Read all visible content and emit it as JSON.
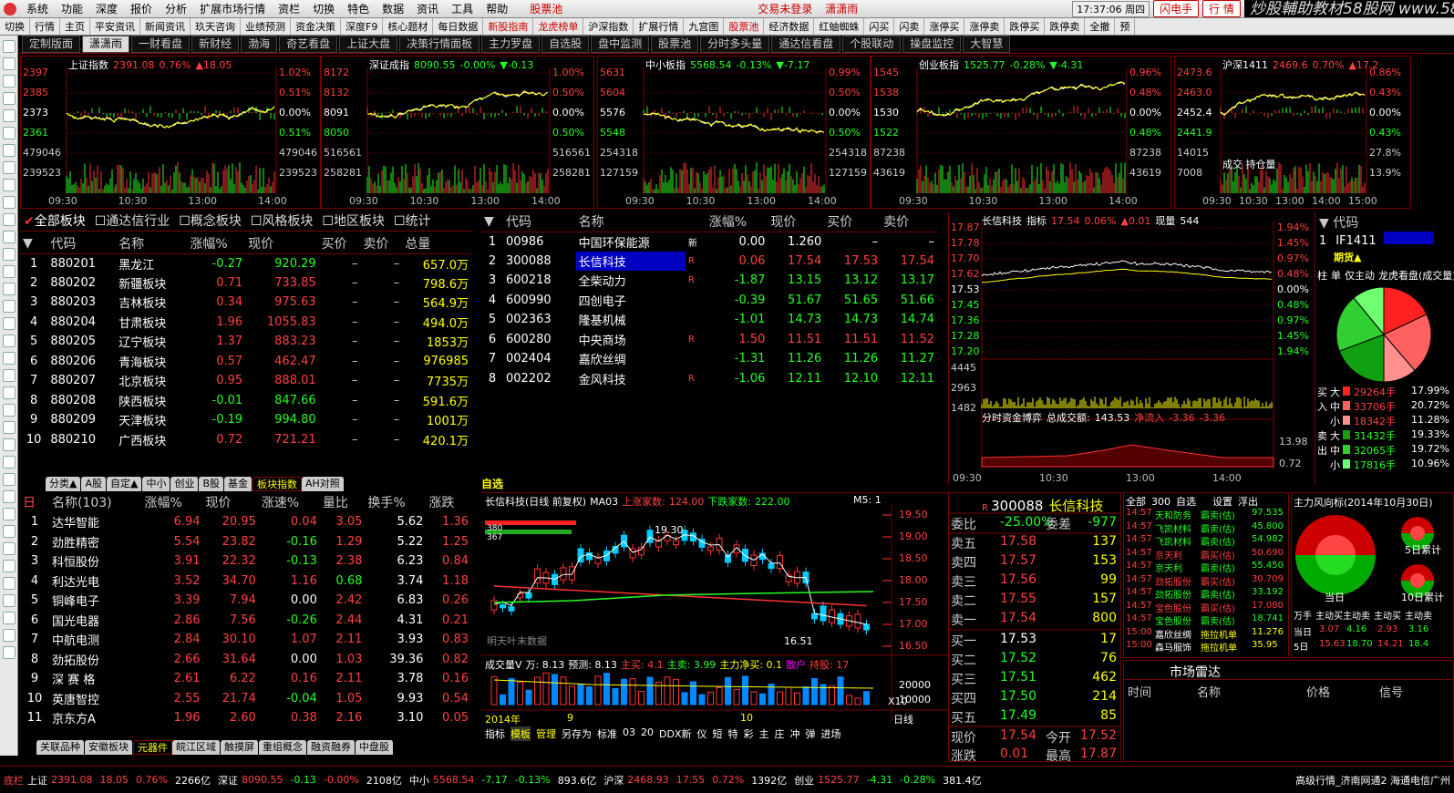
{
  "menu": {
    "items": [
      "系统",
      "功能",
      "深度",
      "报价",
      "分析",
      "扩展市场行情",
      "资栏",
      "切换",
      "特色",
      "数据",
      "资讯",
      "工具",
      "帮助"
    ],
    "stock_pool": "股票池",
    "trade_status": "交易未登录",
    "user": "潇潇雨",
    "clock": "17:37:06 周四",
    "flash_btn": "闪电手",
    "quote_btn": "行 情"
  },
  "watermark": "炒股輔助教材58股网 www.58Gu.com",
  "toolbar2": [
    "切换",
    "行情",
    "主页",
    "平安资讯",
    "新闻资讯",
    "玖天咨询",
    "业绩预测",
    "资金决策",
    "深度F9",
    "核心题材",
    "每日数据",
    "新股指南",
    "龙虎榜单",
    "沪深指数",
    "扩展行情",
    "九宫图",
    "股票池",
    "经济数据",
    "红蚰蜘蛛",
    "闪买",
    "闪卖",
    "涨停买",
    "涨停卖",
    "跌停买",
    "跌停卖",
    "全撤",
    "预"
  ],
  "toolbar3": [
    "定制版面",
    "潇潇雨",
    "一财看盘",
    "新财经",
    "渤海",
    "奇艺看盘",
    "上证大盘",
    "决策行情面板",
    "主力罗盘",
    "自选股",
    "盘中监测",
    "股票池",
    "分时多头量",
    "通达信看盘",
    "个股联动",
    "操盘监控",
    "大智慧"
  ],
  "minis": [
    {
      "name": "上证指数",
      "price": "2391.08",
      "pct": "0.76%",
      "chg": "▲18.05",
      "yl": [
        "2397",
        "2385",
        "2373",
        "2361",
        "479046",
        "239523"
      ],
      "pl": [
        "1.02%",
        "0.51%",
        "0.00%",
        "0.51%",
        "479046",
        "239523"
      ],
      "times": [
        "09:30",
        "10:30",
        "13:00",
        "14:00"
      ]
    },
    {
      "name": "深证成指",
      "price": "8090.55",
      "pct": "-0.00%",
      "chg": "▼-0.13",
      "yl": [
        "8172",
        "8132",
        "8091",
        "8050",
        "516561",
        "258281"
      ],
      "pl": [
        "1.00%",
        "0.50%",
        "0.00%",
        "0.50%",
        "516561",
        "258281"
      ],
      "times": [
        "09:30",
        "10:30",
        "13:00",
        "14:00"
      ]
    },
    {
      "name": "中小板指",
      "price": "5568.54",
      "pct": "-0.13%",
      "chg": "▼-7.17",
      "yl": [
        "5631",
        "5604",
        "5576",
        "5548",
        "254318",
        "127159"
      ],
      "pl": [
        "0.99%",
        "0.50%",
        "0.00%",
        "0.50%",
        "254318",
        "127159"
      ],
      "times": [
        "09:30",
        "10:30",
        "13:00",
        "14:00"
      ]
    },
    {
      "name": "创业板指",
      "price": "1525.77",
      "pct": "-0.28%",
      "chg": "▼-4.31",
      "yl": [
        "1545",
        "1538",
        "1530",
        "1522",
        "87238",
        "43619"
      ],
      "pl": [
        "0.96%",
        "0.48%",
        "0.00%",
        "0.48%",
        "87238",
        "43619"
      ],
      "times": [
        "09:30",
        "10:30",
        "13:00",
        "14:00"
      ]
    },
    {
      "name": "沪深1411",
      "price": "2469.6",
      "pct": "0.70%",
      "chg": "▲17.2",
      "yl": [
        "2473.6",
        "2463.0",
        "2452.4",
        "2441.9",
        "14015",
        "7008"
      ],
      "pl": [
        "0.86%",
        "0.43%",
        "0.00%",
        "0.43%",
        "27.8%",
        "13.9%"
      ],
      "times": [
        "09:30",
        "10:30",
        "13:00",
        "14:00",
        "15:00"
      ],
      "extra": "成交 持仓量"
    }
  ],
  "sector_filter": [
    "全部板块",
    "通达信行业",
    "概念板块",
    "风格板块",
    "地区板块",
    "统计"
  ],
  "sector_table": {
    "headers": [
      "代码",
      "名称",
      "涨幅%",
      "现价",
      "买价",
      "卖价",
      "总量"
    ],
    "rows": [
      [
        "1",
        "880201",
        "黑龙江",
        "-0.27",
        "920.29",
        "–",
        "–",
        "657.0万"
      ],
      [
        "2",
        "880202",
        "新疆板块",
        "0.71",
        "733.85",
        "–",
        "–",
        "798.6万"
      ],
      [
        "3",
        "880203",
        "吉林板块",
        "0.34",
        "975.63",
        "–",
        "–",
        "564.9万"
      ],
      [
        "4",
        "880204",
        "甘肃板块",
        "1.96",
        "1055.83",
        "–",
        "–",
        "494.0万"
      ],
      [
        "5",
        "880205",
        "辽宁板块",
        "1.37",
        "883.23",
        "–",
        "–",
        "1853万"
      ],
      [
        "6",
        "880206",
        "青海板块",
        "0.57",
        "462.47",
        "–",
        "–",
        "976985"
      ],
      [
        "7",
        "880207",
        "北京板块",
        "0.95",
        "888.01",
        "–",
        "–",
        "7735万"
      ],
      [
        "8",
        "880208",
        "陕西板块",
        "-0.01",
        "847.66",
        "–",
        "–",
        "591.6万"
      ],
      [
        "9",
        "880209",
        "天津板块",
        "-0.19",
        "994.80",
        "–",
        "–",
        "1001万"
      ],
      [
        "10",
        "880210",
        "广西板块",
        "0.72",
        "721.21",
        "–",
        "–",
        "420.1万"
      ]
    ]
  },
  "sector_tabs": [
    "分类▲",
    "A股",
    "自定▲",
    "中小",
    "创业",
    "B股",
    "基金",
    "板块指数",
    "AH对照"
  ],
  "watch_table": {
    "headers": [
      "代码",
      "名称",
      "涨幅%",
      "现价",
      "买价",
      "卖价"
    ],
    "rows": [
      [
        "1",
        "00986",
        "中国环保能源",
        "新",
        "0.00",
        "1.260",
        "–",
        "–"
      ],
      [
        "2",
        "300088",
        "长信科技",
        "R",
        "0.06",
        "17.54",
        "17.53",
        "17.54"
      ],
      [
        "3",
        "600218",
        "全柴动力",
        "R",
        "-1.87",
        "13.15",
        "13.12",
        "13.17"
      ],
      [
        "4",
        "600990",
        "四创电子",
        "",
        "-0.39",
        "51.67",
        "51.65",
        "51.66"
      ],
      [
        "5",
        "002363",
        "隆基机械",
        "",
        "-1.01",
        "14.73",
        "14.73",
        "14.74"
      ],
      [
        "6",
        "600280",
        "中央商场",
        "R",
        "1.50",
        "11.51",
        "11.51",
        "11.52"
      ],
      [
        "7",
        "002404",
        "嘉欣丝绸",
        "",
        "-1.31",
        "11.26",
        "11.26",
        "11.27"
      ],
      [
        "8",
        "002202",
        "金风科技",
        "R",
        "-1.06",
        "12.11",
        "12.10",
        "12.11"
      ]
    ]
  },
  "watch_tab": "自选",
  "intraday": {
    "title": "长信科技",
    "ind": "指标",
    "price": "17.54",
    "pct": "0.06%",
    "chg": "▲0.01",
    "vol_label": "现量",
    "vol": "544",
    "yl": [
      "17.87",
      "17.78",
      "17.70",
      "17.62",
      "17.53",
      "17.45",
      "17.36",
      "17.28",
      "17.20",
      "4445",
      "2963",
      "1482"
    ],
    "pl": [
      "1.94%",
      "1.45%",
      "0.97%",
      "0.48%",
      "0.00%",
      "0.48%",
      "0.97%",
      "1.45%",
      "1.94%"
    ],
    "flow_label": "分时资金博弈",
    "vol_total_label": "总成交额:",
    "vol_total": "143.53",
    "net_in": "净流入",
    "ni1": "-3.36",
    "ni2": "-3.36",
    "f1": "13.98",
    "f2": "0.72",
    "times": [
      "09:30",
      "10:30",
      "13:00",
      "14:00"
    ]
  },
  "fut": {
    "header": "代码",
    "row_no": "1",
    "code": "IF1411",
    "tag": "期货▲",
    "tabs": [
      "柱",
      "单",
      "仅主动",
      "龙虎看盘(成交量)"
    ],
    "buy_label": "买入",
    "sell_label": "卖出",
    "buy": [
      [
        "大",
        "29264手",
        "17.99%"
      ],
      [
        "中",
        "33706手",
        "20.72%"
      ],
      [
        "小",
        "18342手",
        "11.28%"
      ]
    ],
    "sell": [
      [
        "大",
        "31432手",
        "19.33%"
      ],
      [
        "中",
        "32065手",
        "19.72%"
      ],
      [
        "小",
        "17816手",
        "10.96%"
      ]
    ]
  },
  "kline": {
    "title": "长信科技(日线 前复权)",
    "ma": "MA03",
    "up_label": "上涨家数:",
    "up": "124.00",
    "down_label": "下跌家数:",
    "down": "222.00",
    "period": "M5: 1",
    "hi": "19.30",
    "lo": "16.51",
    "yl": [
      "19.50",
      "19.00",
      "18.50",
      "18.00",
      "17.50",
      "17.00",
      "16.50"
    ],
    "note": "明天叶末数据",
    "s1": "380",
    "s2": "367",
    "vol_title": "成交量V",
    "vol_val": "万: 8.13",
    "vol_pred": "预测: 8.13",
    "zm": "主买: 4.1",
    "zs": "主卖: 3.99",
    "zj": "主力净买: 0.1",
    "sh": "散户",
    "cc": "持股: 17",
    "vyl": [
      "20000",
      "10000"
    ],
    "x10": "X10",
    "dates": [
      "2014年",
      "9",
      "10"
    ],
    "dayline": "日线",
    "bottom_tabs": [
      "指标",
      "模板",
      "管理",
      "另存为",
      "标准",
      "03",
      "20",
      "DDX新",
      "仪",
      "短",
      "特",
      "彩",
      "主",
      "庄",
      "冲",
      "弹",
      "进场"
    ]
  },
  "quote": {
    "code": "300088",
    "name": "长信科技",
    "wb_label": "委比",
    "wb": "-25.00%",
    "wc_label": "委差",
    "wc": "-977",
    "sells": [
      [
        "卖五",
        "17.58",
        "137"
      ],
      [
        "卖四",
        "17.57",
        "153"
      ],
      [
        "卖三",
        "17.56",
        "99"
      ],
      [
        "卖二",
        "17.55",
        "157"
      ],
      [
        "卖一",
        "17.54",
        "800"
      ]
    ],
    "buys": [
      [
        "买一",
        "17.53",
        "17"
      ],
      [
        "买二",
        "17.52",
        "76"
      ],
      [
        "买三",
        "17.51",
        "462"
      ],
      [
        "买四",
        "17.50",
        "214"
      ],
      [
        "买五",
        "17.49",
        "85"
      ]
    ],
    "now_label": "现价",
    "now": "17.54",
    "open_label": "今开",
    "open": "17.52",
    "chg_label": "涨跌",
    "chg": "0.01",
    "high_label": "最高",
    "high": "17.87"
  },
  "ticks": {
    "tabs": [
      "全部",
      "300",
      "自选",
      "设置",
      "浮出"
    ],
    "rows": [
      [
        "14:57",
        "天和防务",
        "霸卖(估)",
        "97.535"
      ],
      [
        "14:57",
        "飞凯材料",
        "霸卖(估)",
        "45.800"
      ],
      [
        "14:57",
        "飞凯材料",
        "霸卖(估)",
        "54.982"
      ],
      [
        "14:57",
        "京天利",
        "霸买(估)",
        "50.690"
      ],
      [
        "14:57",
        "京天利",
        "霸卖(估)",
        "55.450"
      ],
      [
        "14:57",
        "劲拓股份",
        "霸买(估)",
        "30.709"
      ],
      [
        "14:57",
        "劲拓股份",
        "霸卖(估)",
        "33.192"
      ],
      [
        "14:57",
        "宝色股份",
        "霸买(估)",
        "17.080"
      ],
      [
        "14:57",
        "宝色股份",
        "霸卖(估)",
        "18.741"
      ],
      [
        "15:00",
        "嘉欣丝绸",
        "拖拉机单",
        "11.276"
      ],
      [
        "15:00",
        "森马服饰",
        "拖拉机单",
        "35.95"
      ]
    ]
  },
  "radar": {
    "title": "市场雷达",
    "headers": [
      "时间",
      "名称",
      "价格",
      "信号"
    ]
  },
  "flow": {
    "title": "主力风向标(2014年10月30日)",
    "today": "当日",
    "d5": "5日累计",
    "d10": "10日累计",
    "cols": [
      "万手",
      "主动买",
      "主动卖",
      "主动买",
      "主动卖"
    ],
    "rows": [
      [
        "当日",
        "3.07",
        "4.16",
        "2.93",
        "3.16"
      ],
      [
        "5日",
        "15.63",
        "18.70",
        "14.21",
        "18.4"
      ]
    ]
  },
  "lower_tabs": [
    "关联品种",
    "安徽板块",
    "元器件",
    "皖江区域",
    "触摸屏",
    "重组概念",
    "融资融券",
    "中盘股"
  ],
  "lower_table": {
    "count_label": "名称(103)",
    "headers": [
      "涨幅%",
      "现价",
      "涨速%",
      "量比",
      "换手%",
      "涨跌"
    ],
    "rows": [
      [
        "1",
        "达华智能",
        "6.94",
        "20.95",
        "0.04",
        "3.05",
        "5.62",
        "1.36"
      ],
      [
        "2",
        "劲胜精密",
        "5.54",
        "23.82",
        "-0.16",
        "1.29",
        "5.22",
        "1.25"
      ],
      [
        "3",
        "科恒股份",
        "3.91",
        "22.32",
        "-0.13",
        "2.38",
        "6.23",
        "0.84"
      ],
      [
        "4",
        "利达光电",
        "3.52",
        "34.70",
        "1.16",
        "0.68",
        "3.74",
        "1.18"
      ],
      [
        "5",
        "铜峰电子",
        "3.39",
        "7.94",
        "0.00",
        "2.42",
        "6.83",
        "0.26"
      ],
      [
        "6",
        "国光电器",
        "2.86",
        "7.56",
        "-0.26",
        "2.44",
        "4.31",
        "0.21"
      ],
      [
        "7",
        "中航电测",
        "2.84",
        "30.10",
        "1.07",
        "2.11",
        "3.93",
        "0.83"
      ],
      [
        "8",
        "劲拓股份",
        "2.66",
        "31.64",
        "0.00",
        "1.03",
        "39.36",
        "0.82"
      ],
      [
        "9",
        "深 赛 格",
        "2.61",
        "6.22",
        "0.16",
        "2.11",
        "3.78",
        "0.16"
      ],
      [
        "10",
        "英唐智控",
        "2.55",
        "21.74",
        "-0.04",
        "1.05",
        "9.93",
        "0.54"
      ],
      [
        "11",
        "京东方A",
        "1.96",
        "2.60",
        "0.38",
        "2.16",
        "3.10",
        "0.05"
      ]
    ]
  },
  "status": {
    "items": [
      [
        "底栏",
        ""
      ],
      [
        "上证",
        "2391.08"
      ],
      [
        "",
        "18.05"
      ],
      [
        "",
        "0.76%"
      ],
      [
        "",
        "2266亿"
      ],
      [
        "深证",
        "8090.55"
      ],
      [
        "",
        "-0.13"
      ],
      [
        "",
        "-0.00%"
      ],
      [
        "",
        "2108亿"
      ],
      [
        "中小",
        "5568.54"
      ],
      [
        "",
        "-7.17"
      ],
      [
        "",
        "-0.13%"
      ],
      [
        "",
        "893.6亿"
      ],
      [
        "沪深",
        "2468.93"
      ],
      [
        "",
        "17.55"
      ],
      [
        "",
        "0.72%"
      ],
      [
        "",
        "1392亿"
      ],
      [
        "创业",
        "1525.77"
      ],
      [
        "",
        "-4.31"
      ],
      [
        "",
        "-0.28%"
      ],
      [
        "",
        "381.4亿"
      ]
    ],
    "right": "高级行情_济南网通2 海通电信广州"
  },
  "colors": {
    "up": "#ff4040",
    "down": "#22ff22",
    "border": "#700000",
    "highlight": "#0000c0"
  }
}
